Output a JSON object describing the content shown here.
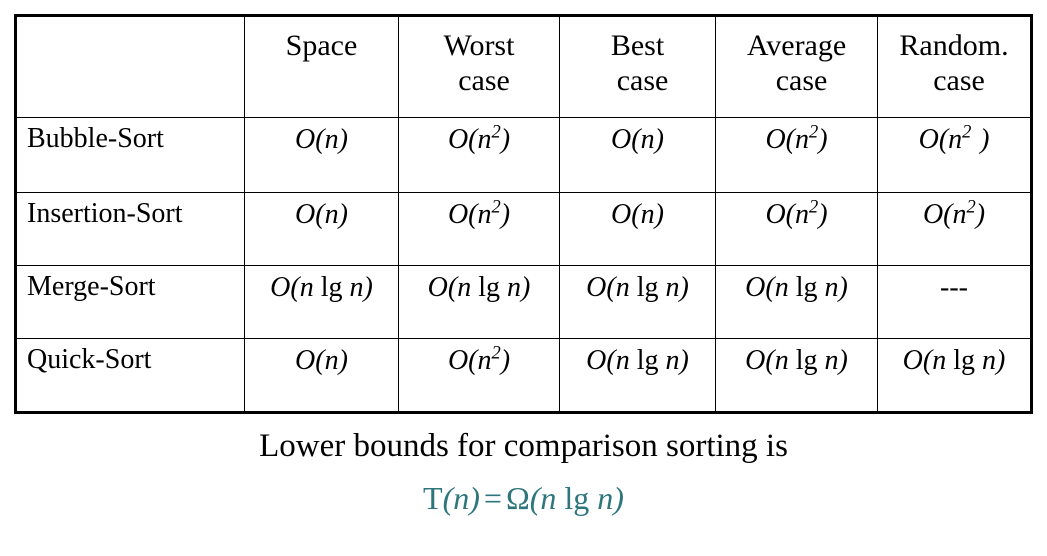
{
  "table": {
    "columns": [
      {
        "line1": "",
        "line2": ""
      },
      {
        "line1": "Space",
        "line2": ""
      },
      {
        "line1": "Worst",
        "line2": "case"
      },
      {
        "line1": "Best",
        "line2": "case"
      },
      {
        "line1": "Average",
        "line2": "case"
      },
      {
        "line1": "Random.",
        "line2": "case"
      }
    ],
    "rows": [
      {
        "algorithm": "Bubble-Sort",
        "space": "O(n)",
        "worst_case": "O(n2)",
        "best_case": "O(n)",
        "average_case": "O(n2)",
        "random_case": "O(n2 )"
      },
      {
        "algorithm": "Insertion-Sort",
        "space": "O(n)",
        "worst_case": "O(n2)",
        "best_case": "O(n)",
        "average_case": "O(n2)",
        "random_case": "O(n2)"
      },
      {
        "algorithm": "Merge-Sort",
        "space": "O(n lg n)",
        "worst_case": "O(n lg n)",
        "best_case": "O(n lg n)",
        "average_case": "O(n lg n)",
        "random_case": "---"
      },
      {
        "algorithm": "Quick-Sort",
        "space": "O(n)",
        "worst_case": "O(n2)",
        "best_case": "O(n lg n)",
        "average_case": "O(n lg n)",
        "random_case": "O(n lg n)"
      }
    ]
  },
  "caption": {
    "text": "Lower bounds for comparison sorting is"
  },
  "formula": {
    "text": "T(n) = Ω(n lg n)",
    "function_name": "T",
    "argument": "n",
    "equals": "=",
    "omega": "Ω",
    "bound": "n lg n",
    "color": "#2e767c"
  }
}
